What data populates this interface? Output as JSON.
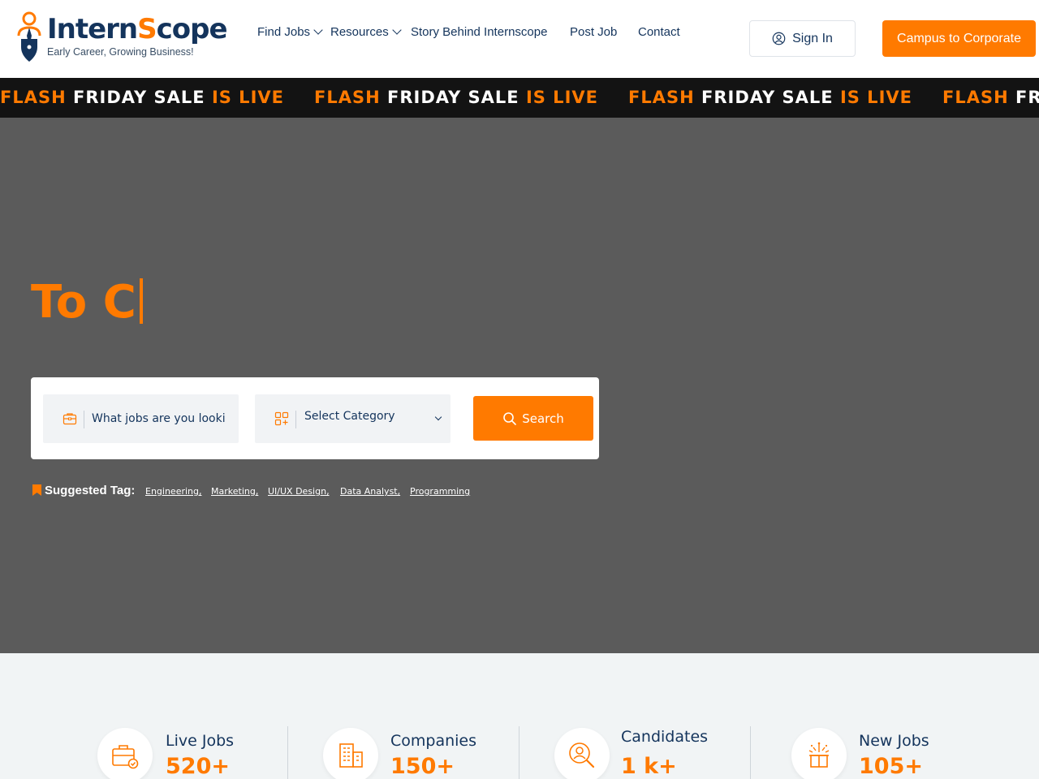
{
  "brand": {
    "name_part1": "Intern",
    "name_part2": "S",
    "name_part3": "cope",
    "tagline": "Early Career, Growing Business!",
    "accent_color": "#ff7a00",
    "navy_color": "#14345c"
  },
  "nav": {
    "items": [
      {
        "label": "Find Jobs",
        "has_dropdown": true
      },
      {
        "label": "Resources",
        "has_dropdown": true
      },
      {
        "label": "Story Behind Internscope",
        "has_dropdown": false
      },
      {
        "label": "Post Job",
        "has_dropdown": false
      },
      {
        "label": "Contact",
        "has_dropdown": false
      }
    ],
    "signin_label": "Sign In",
    "cta_label": "Campus to Corporate"
  },
  "ticker": {
    "part1": "FLASH",
    "part2": "FRIDAY SALE",
    "part3": "IS LIVE"
  },
  "hero": {
    "title": "To C",
    "search": {
      "keyword_placeholder": "What jobs are you looking for?",
      "category_selected": "Select Category",
      "button_label": "Search"
    },
    "suggested_label": "Suggested Tag:",
    "tags": [
      "Engineering,",
      "Marketing,",
      "UI/UX Design,",
      "Data Analyst,",
      "Programming"
    ]
  },
  "stats": [
    {
      "label": "Live Jobs",
      "value": "520+",
      "icon": "briefcase-icon"
    },
    {
      "label": "Companies",
      "value": "150+",
      "icon": "building-icon"
    },
    {
      "label": "Candidates",
      "value": "1 k+",
      "icon": "candidate-search-icon"
    },
    {
      "label": "New Jobs",
      "value": "105+",
      "icon": "gift-box-icon"
    }
  ]
}
